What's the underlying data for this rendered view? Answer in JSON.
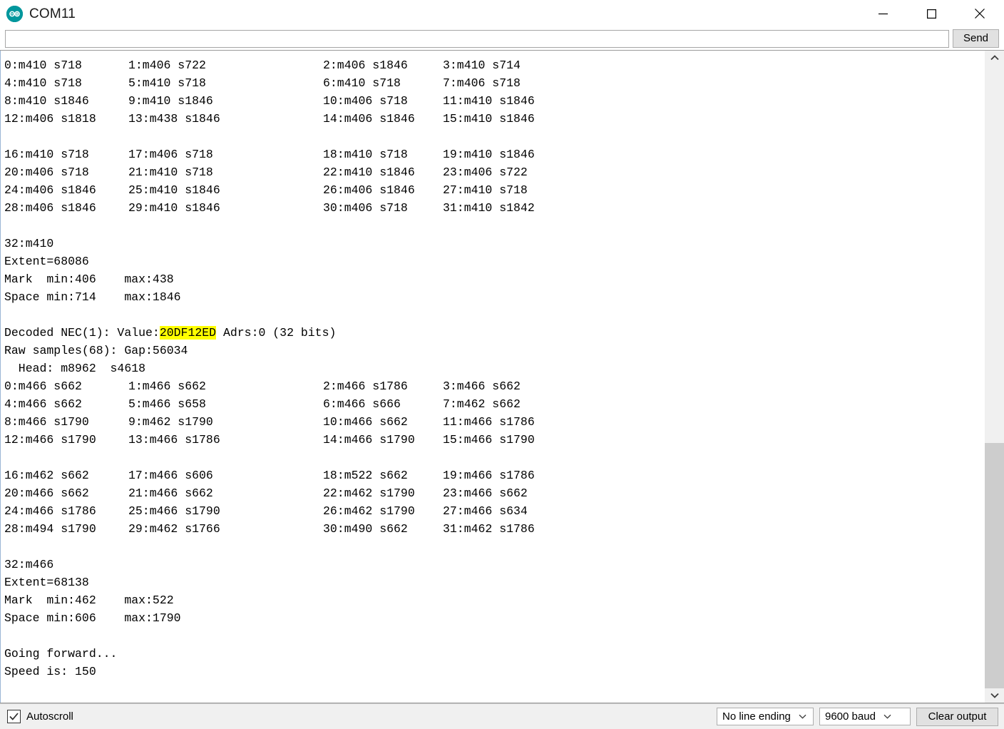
{
  "window": {
    "title": "COM11",
    "logo_icon": "arduino-infinity-logo",
    "minimize_icon": "minimize-icon",
    "maximize_icon": "maximize-icon",
    "close_icon": "close-icon"
  },
  "send": {
    "input_value": "",
    "placeholder": "",
    "button_label": "Send"
  },
  "console": {
    "clipped_top_line": "  Head: m8962  s4618",
    "blocks": [
      {
        "rows": [
          [
            "0:m410 s718",
            "1:m406 s722",
            "2:m406 s1846",
            "3:m410 s714"
          ],
          [
            "4:m410 s718",
            "5:m410 s718",
            "6:m410 s718",
            "7:m406 s718"
          ],
          [
            "8:m410 s1846",
            "9:m410 s1846",
            "10:m406 s718",
            "11:m410 s1846"
          ],
          [
            "12:m406 s1818",
            "13:m438 s1846",
            "14:m406 s1846",
            "15:m410 s1846"
          ],
          [
            "",
            "",
            "",
            ""
          ],
          [
            "16:m410 s718",
            "17:m406 s718",
            "18:m410 s718",
            "19:m410 s1846"
          ],
          [
            "20:m406 s718",
            "21:m410 s718",
            "22:m410 s1846",
            "23:m406 s722"
          ],
          [
            "24:m406 s1846",
            "25:m410 s1846",
            "26:m406 s1846",
            "27:m410 s718"
          ],
          [
            "28:m406 s1846",
            "29:m410 s1846",
            "30:m406 s718",
            "31:m410 s1842"
          ]
        ],
        "tail": [
          "",
          "32:m410",
          "Extent=68086",
          "Mark  min:406    max:438",
          "Space min:714    max:1846",
          ""
        ]
      }
    ],
    "decoded": {
      "prefix": "Decoded NEC(1): Value:",
      "value": "20DF12ED",
      "suffix": " Adrs:0 (32 bits)",
      "highlight_color": "#ffff00"
    },
    "raw_samples_line": "Raw samples(68): Gap:56034",
    "head_line": "  Head: m8962  s4618",
    "block2_rows": [
      [
        "0:m466 s662",
        "1:m466 s662",
        "2:m466 s1786",
        "3:m466 s662"
      ],
      [
        "4:m466 s662",
        "5:m466 s658",
        "6:m466 s666",
        "7:m462 s662"
      ],
      [
        "8:m466 s1790",
        "9:m462 s1790",
        "10:m466 s662",
        "11:m466 s1786"
      ],
      [
        "12:m466 s1790",
        "13:m466 s1786",
        "14:m466 s1790",
        "15:m466 s1790"
      ],
      [
        "",
        "",
        "",
        ""
      ],
      [
        "16:m462 s662",
        "17:m466 s606",
        "18:m522 s662",
        "19:m466 s1786"
      ],
      [
        "20:m466 s662",
        "21:m466 s662",
        "22:m462 s1790",
        "23:m466 s662"
      ],
      [
        "24:m466 s1786",
        "25:m466 s1790",
        "26:m462 s1790",
        "27:m466 s634"
      ],
      [
        "28:m494 s1790",
        "29:m462 s1766",
        "30:m490 s662",
        "31:m462 s1786"
      ]
    ],
    "block2_tail": [
      "",
      "32:m466",
      "Extent=68138",
      "Mark  min:462    max:522",
      "Space min:606    max:1790",
      "",
      "Going forward...",
      "Speed is: 150"
    ]
  },
  "scrollbar": {
    "up_arrow_icon": "chevron-up-icon",
    "down_arrow_icon": "chevron-down-icon"
  },
  "statusbar": {
    "autoscroll_label": "Autoscroll",
    "autoscroll_checked": true,
    "check_icon": "check-icon",
    "line_ending_value": "No line ending",
    "baud_value": "9600 baud",
    "clear_label": "Clear output",
    "dropdown_icon": "chevron-down-icon"
  }
}
